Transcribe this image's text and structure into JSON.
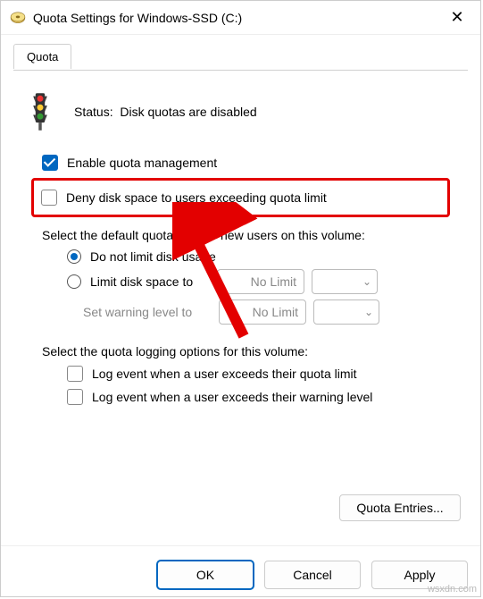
{
  "window": {
    "title": "Quota Settings for Windows-SSD (C:)"
  },
  "tabs": {
    "quota": "Quota"
  },
  "status": {
    "prefix": "Status:",
    "text": "Disk quotas are disabled"
  },
  "checkboxes": {
    "enable": "Enable quota management",
    "deny": "Deny disk space to users exceeding quota limit"
  },
  "limit_section": {
    "heading": "Select the default quota limit for new users on this volume:",
    "opt_nolimit": "Do not limit disk usage",
    "opt_limit": "Limit disk space to",
    "warning": "Set warning level to",
    "nolimit_value": "No Limit",
    "chevron": "⌄"
  },
  "logging_section": {
    "heading": "Select the quota logging options for this volume:",
    "log_exceed": "Log event when a user exceeds their quota limit",
    "log_warning": "Log event when a user exceeds their warning level"
  },
  "buttons": {
    "entries": "Quota Entries...",
    "ok": "OK",
    "cancel": "Cancel",
    "apply": "Apply"
  },
  "watermark": "wsxdn.com"
}
